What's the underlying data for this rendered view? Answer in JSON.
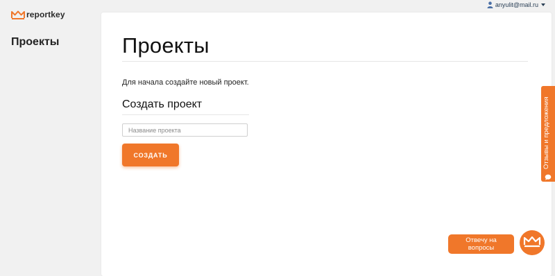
{
  "app": {
    "logo_text": "reportkey",
    "logo_icon": "crown-icon"
  },
  "sidebar": {
    "title": "Проекты"
  },
  "user_menu": {
    "email": "anyulit@mail.ru",
    "icon": "user-icon"
  },
  "main": {
    "title": "Проекты",
    "intro": "Для начала создайте новый проект.",
    "create_section": {
      "title": "Создать проект",
      "input_placeholder": "Название проекта",
      "input_value": "",
      "button_label": "СОЗДАТЬ"
    }
  },
  "feedback_tab": {
    "label": "Отзывы и предложения",
    "icon": "chat-bubble-icon"
  },
  "help_widget": {
    "button_label": "Отвечу на вопросы",
    "avatar_icon": "crown-icon"
  },
  "colors": {
    "accent": "#f0772a",
    "background": "#f1f1f1",
    "panel": "#ffffff"
  }
}
